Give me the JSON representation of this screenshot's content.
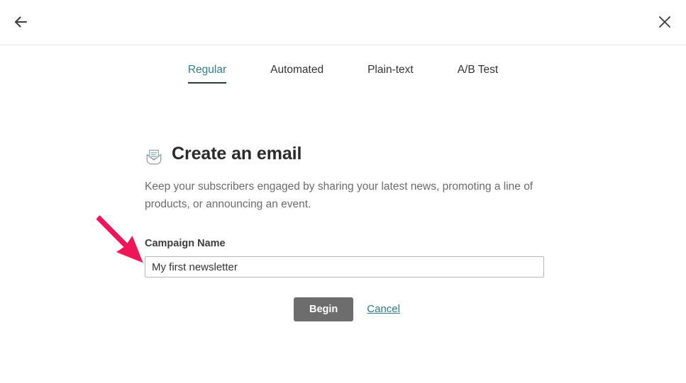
{
  "window": {
    "back_icon": "arrow-left-icon",
    "close_icon": "close-x-icon"
  },
  "tabs": [
    {
      "label": "Regular",
      "active": true
    },
    {
      "label": "Automated",
      "active": false
    },
    {
      "label": "Plain-text",
      "active": false
    },
    {
      "label": "A/B Test",
      "active": false
    }
  ],
  "main": {
    "icon": "open-envelope-letter-icon",
    "title": "Create an email",
    "description": "Keep your subscribers engaged by sharing your latest news, promoting a line of products, or announcing an event.",
    "form": {
      "campaign_name_label": "Campaign Name",
      "campaign_name_value": "My first newsletter",
      "campaign_name_placeholder": "Campaign Name"
    },
    "actions": {
      "begin_label": "Begin",
      "cancel_label": "Cancel"
    }
  },
  "annotation": {
    "arrow_icon": "pointer-arrow-annotation",
    "color": "#ee1559"
  },
  "colors": {
    "accent_teal": "#307f8c",
    "link_teal": "#2d7a8c",
    "button_gray": "#6d6d6d",
    "annotation_pink": "#ee1559",
    "border_gray": "#b9b9b9",
    "divider_gray": "#e3e3e3",
    "text_dark": "#333333",
    "text_muted": "#6b6b6b"
  }
}
